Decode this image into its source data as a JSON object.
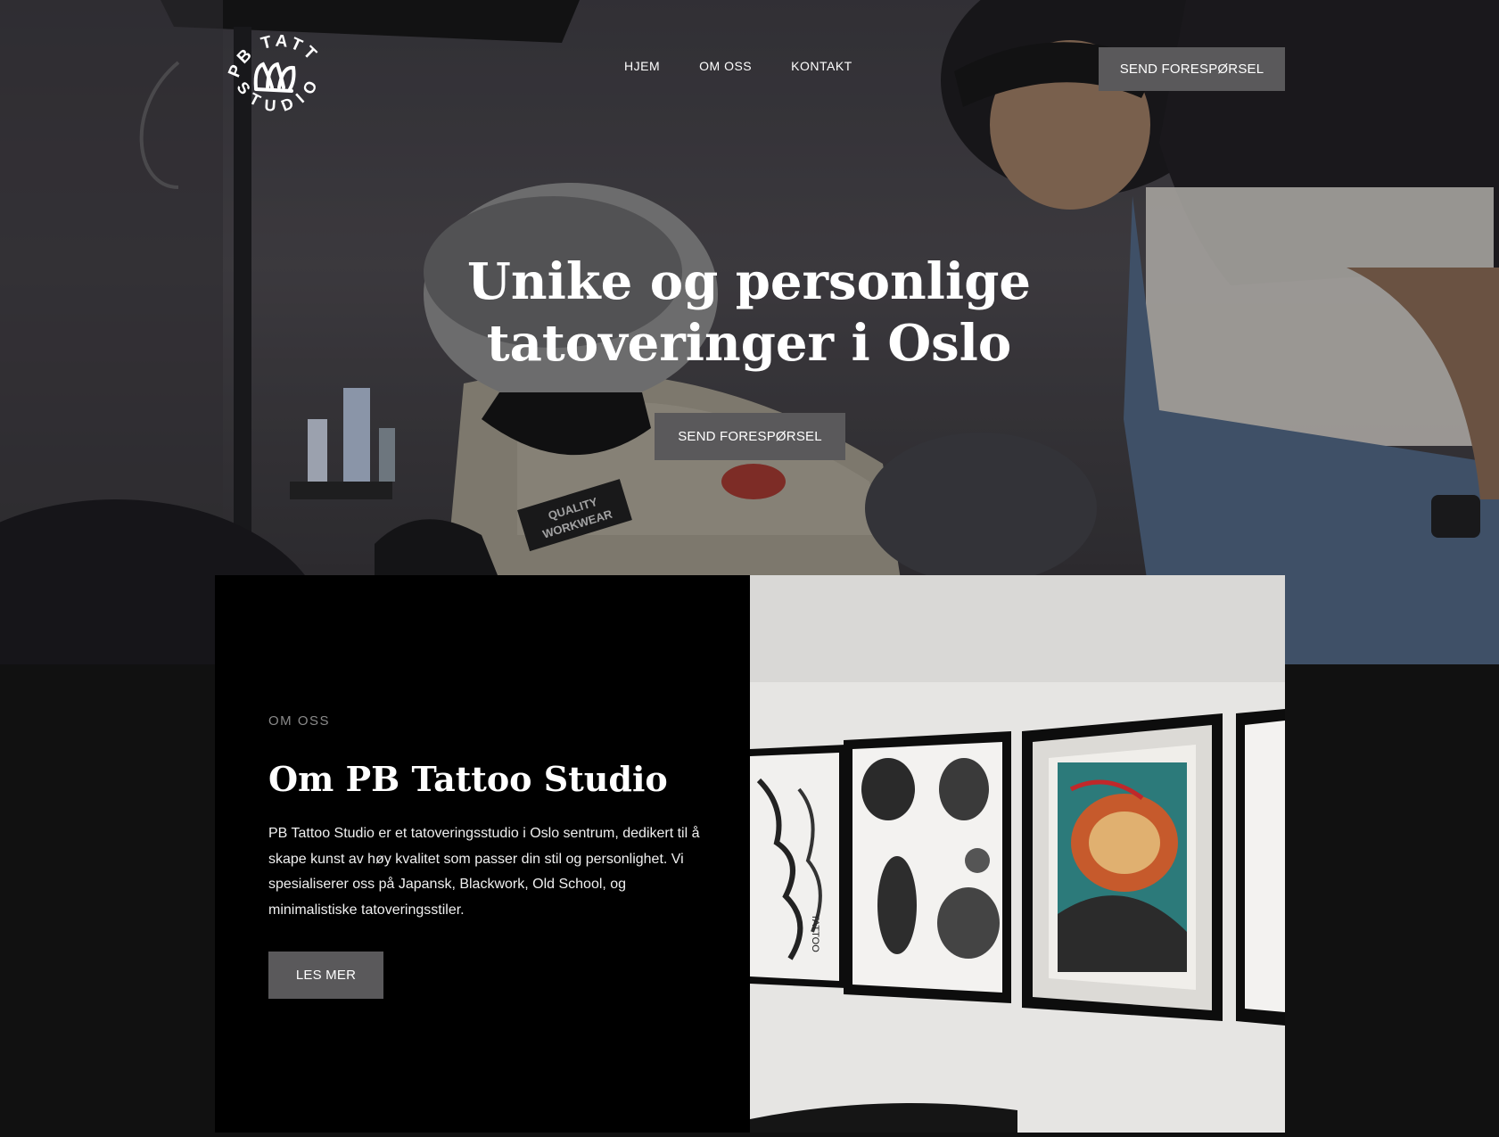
{
  "header": {
    "logo_text_top": "PB TATTOO",
    "logo_text_bottom": "STUDIO",
    "nav": [
      {
        "label": "HJEM"
      },
      {
        "label": "OM OSS"
      },
      {
        "label": "KONTAKT"
      }
    ],
    "cta_label": "SEND FORESPØRSEL"
  },
  "hero": {
    "title_line1": "Unike og personlige",
    "title_line2": "tatoveringer i Oslo",
    "cta_label": "SEND FORESPØRSEL",
    "badge_text_1": "QUALITY",
    "badge_text_2": "WORKWEAR"
  },
  "about": {
    "eyebrow": "OM OSS",
    "heading": "Om PB Tattoo Studio",
    "body": "PB Tattoo Studio er et tatoveringsstudio i Oslo sentrum, dedikert til å skape kunst av høy kvalitet som passer din stil og personlighet. Vi spesialiserer oss på Japansk, Blackwork, Old School, og minimalistiske tatoveringsstiler.",
    "button_label": "LES MER",
    "frame_text": "TATTOO"
  },
  "colors": {
    "page_bg": "#111111",
    "button_bg": "#5a595b",
    "panel_bg": "#000000",
    "text": "#ffffff",
    "eyebrow": "#8a8a8a"
  },
  "icons": {
    "logo": "pb-tattoo-logo-icon",
    "hands": "hands-icon"
  }
}
